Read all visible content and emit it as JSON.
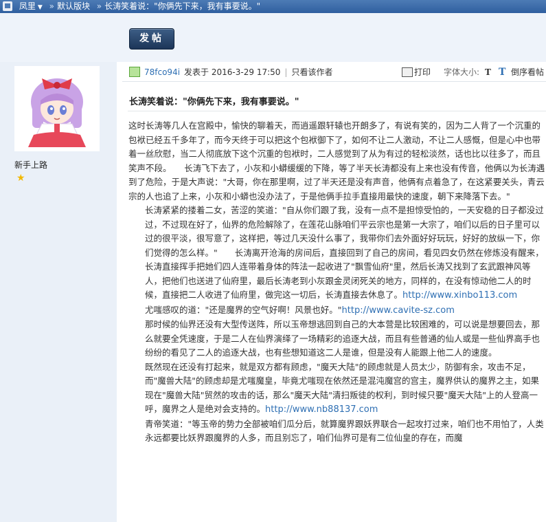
{
  "breadcrumb": {
    "user_menu": "凤里",
    "forum": "默认版块",
    "thread": "长涛笑着说：\"你俩先下来，我有事要说。\""
  },
  "toolbar": {
    "post_button": "发帖"
  },
  "user": {
    "rank": "新手上路",
    "avatar_icon": "avatar-image",
    "star_icon": "☆"
  },
  "post_header": {
    "author": "78fco94i",
    "posted_prefix": "发表于",
    "timestamp": "2016-3-29 17:50",
    "only_author": "只看该作者",
    "print": "打印",
    "font_size_label": "字体大小:",
    "font_size_t": "T",
    "reverse_t": "T",
    "reverse_label": "倒序看帖"
  },
  "post": {
    "title": "长涛笑着说：\"你俩先下来，我有事要说。\"",
    "p1": "这时长涛等几人在宫殿中，愉快的聊着天，而逍遥跟轩辕也开朗多了，有说有笑的，因为二人背了一个沉重的包袱已经五千多年了，而今天终于可以把这个包袱御下了，如何不让二人激动，不让二人感慨，但是心中也带着一丝欣慰，当二人彻底放下这个沉重的包袱时，二人感觉到了从为有过的轻松淡然，话也比以往多了，而且笑声不段。　　长涛飞下去了，小灰和小蟒缓缓的下降，等了半天长涛都没有上来也没有传音，他俩以为长涛遇到了危险，于是大声说：\"大哥，你在那里啊，过了半天还是没有声音，他俩有点着急了，在这紧要关头，青云宗的人也追了上来，小灰和小蟒也没办法了，于是他俩手拉手直接用最快的速度，朝下来降落下去。\"",
    "p2": "长涛紧紧的搂着二女，苦涩的笑道：\"自从你们跟了我，没有一点不是担惊受怕的，一天安稳的日子都没过过，不过现在好了，仙界的危险解除了，在莲花山脉咱们平云宗也是第一大宗了，咱们以后的日子里可以过的很平淡，很写意了，这样把，等过几天没什么事了，我带你们去外面好好玩玩，好好的放纵一下，你们觉得的怎么样。\"　　长涛离开沧海的房间后，直接回到了自己的房间，看见四女仍然在修炼没有醒来，长涛直接挥手把她们四人连带着身体的阵法一起收进了\"飘雪仙府\"里，然后长涛又找到了玄武跟神风等人，把他们也送进了仙府里，最后长涛老到小灰跟金灵闭死关的地方，同样的，在没有惊动他二人的时候，直接把二人收进了仙府里，做完这一切后，长涛直接去休息了。",
    "link1": "http://www.xinbo113.com",
    "p3": "尤嗤感叹的道：\"还是魔界的空气好啊！风景也好。\"",
    "link2": "http://www.cavite-sz.com",
    "p4": "那时候的仙界还没有大型传送阵，所以玉帝想逃回到自己的大本营是比较困难的，可以说是想要回去，那么就要全凭速度，于是二人在仙界演绎了一场精彩的追逐大战，而且有些普通的仙人或是一些仙界高手也纷纷的看见了二人的追逐大战，也有些想知道这二人是谁，但是没有人能跟上他二人的速度。",
    "p5": "既然现在还没有打起来，就是双方都有顾虑，\"魔天大陆\"的顾虑就是人员太少，防御有余，攻击不足，而\"魔兽大陆\"的顾虑却是尤嗤魔皇，毕竟尤嗤现在依然还是混沌魔宫的宫主，魔界供认的魔界之主，如果现在\"魔兽大陆\"贸然的攻击的话，那么\"魔天大陆\"清扫叛徒的权利，到时候只要\"魔天大陆\"上的人登高一呼，魔界之人是绝对会支持的。",
    "link3": "http://www.nb88137.com",
    "p6": "青帝笑道：\"等玉帝的势力全部被咱们瓜分后，就算魔界跟妖界联合一起攻打过来，咱们也不用怕了，人类永远都要比妖界跟魔界的人多，而且别忘了，咱们仙界可是有二位仙皇的存在，而魔"
  }
}
